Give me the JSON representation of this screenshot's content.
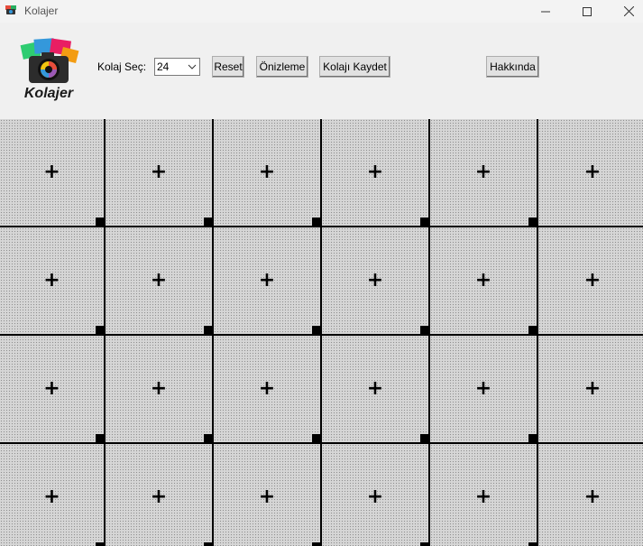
{
  "window": {
    "title": "Kolajer",
    "app_icon": "kolajer-app-icon",
    "controls": [
      "minimize-icon",
      "maximize-icon",
      "close-icon"
    ]
  },
  "toolbar": {
    "logo_text": "Kolajer",
    "combo_label": "Kolaj Seç:",
    "combo_value": "24",
    "reset_label": "Reset",
    "preview_label": "Önizleme",
    "save_label": "Kolajı Kaydet",
    "about_label": "Hakkında"
  },
  "grid": {
    "columns": 6,
    "rows": 4,
    "cell_icon": "plus-icon",
    "handle_icon": "resize-handle-square",
    "cell_symbol": "+",
    "line_color": "#000000",
    "background_color": "#d6d6d6"
  }
}
